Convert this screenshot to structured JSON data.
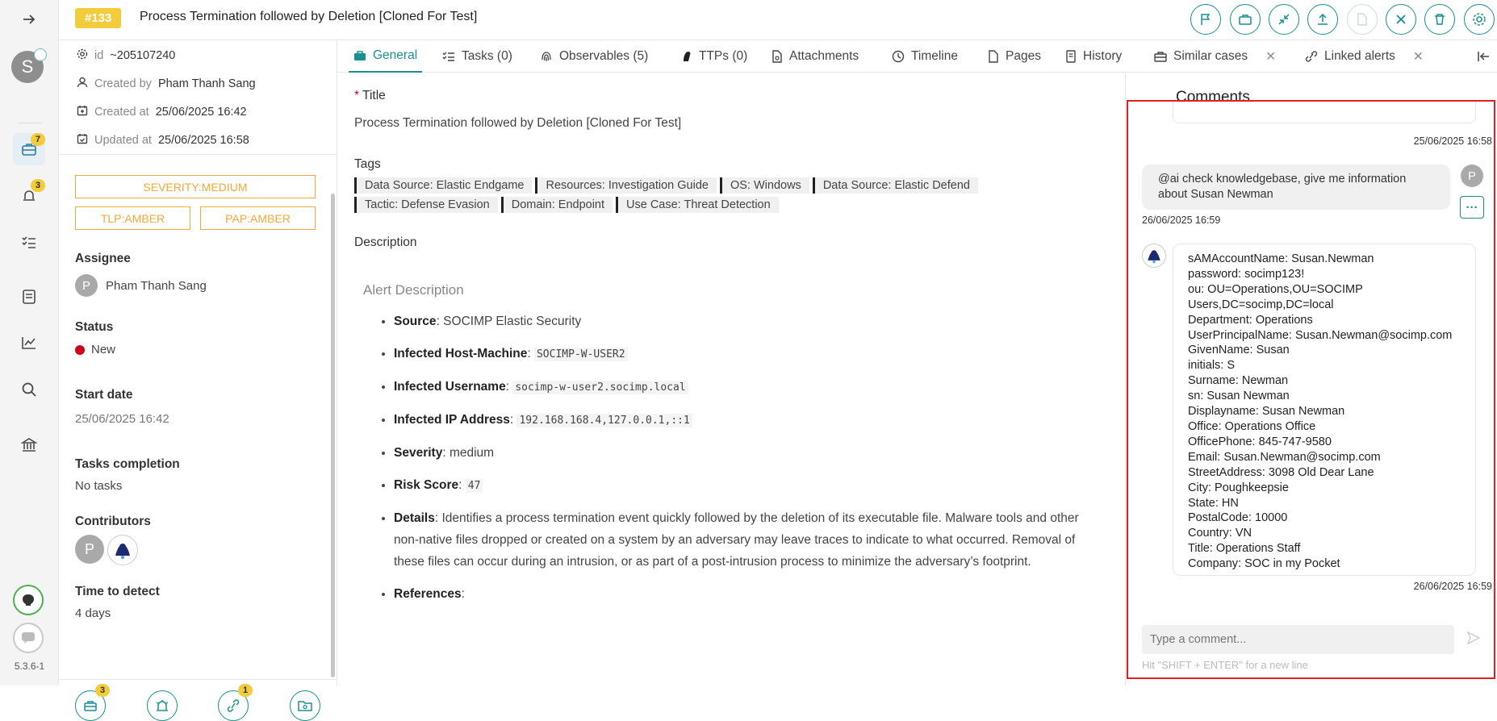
{
  "nav": {
    "avatar_letter": "S",
    "cases_badge": "7",
    "alerts_badge": "3",
    "version": "5.3.6-1"
  },
  "header": {
    "case_number": "#133",
    "title": "Process Termination followed by Deletion [Cloned For Test]"
  },
  "details": {
    "id_label": "id",
    "id_value": "~205107240",
    "created_by_label": "Created by",
    "created_by": "Pham Thanh Sang",
    "created_at_label": "Created at",
    "created_at": "25/06/2025 16:42",
    "updated_at_label": "Updated at",
    "updated_at": "25/06/2025 16:58",
    "severity": "SEVERITY:MEDIUM",
    "tlp": "TLP:AMBER",
    "pap": "PAP:AMBER",
    "assignee_label": "Assignee",
    "assignee_initial": "P",
    "assignee": "Pham Thanh Sang",
    "status_label": "Status",
    "status": "New",
    "status_color": "#d0021b",
    "start_date_label": "Start date",
    "start_date": "25/06/2025 16:42",
    "tasks_label": "Tasks completion",
    "tasks_value": "No tasks",
    "contributors_label": "Contributors",
    "contributor_initial": "P",
    "ttd_label": "Time to detect",
    "ttd_value": "4 days"
  },
  "bottom_badges": {
    "cases": "3",
    "observables": "1"
  },
  "tabs": [
    {
      "label": "General"
    },
    {
      "label": "Tasks (0)"
    },
    {
      "label": "Observables (5)"
    },
    {
      "label": "TTPs (0)"
    },
    {
      "label": "Attachments"
    },
    {
      "label": "Timeline"
    },
    {
      "label": "Pages"
    },
    {
      "label": "History"
    },
    {
      "label": "Similar cases"
    },
    {
      "label": "Linked alerts"
    }
  ],
  "general": {
    "title_label": "Title",
    "required_mark": "*",
    "title_value": "Process Termination followed by Deletion [Cloned For Test]",
    "tags_label": "Tags",
    "tags": [
      "Data Source: Elastic Endgame",
      "Resources: Investigation Guide",
      "OS: Windows",
      "Data Source: Elastic Defend",
      "Tactic: Defense Evasion",
      "Domain: Endpoint",
      "Use Case: Threat Detection"
    ],
    "description_label": "Description",
    "alert_heading": "Alert Description",
    "items": [
      {
        "k": "Source",
        "v": ": SOCIMP Elastic Security"
      },
      {
        "k": "Infected Host-Machine",
        "v": ": ",
        "code": "SOCIMP-W-USER2"
      },
      {
        "k": "Infected Username",
        "v": ": ",
        "code": "socimp-w-user2.socimp.local"
      },
      {
        "k": "Infected IP Address",
        "v": ": ",
        "code": "192.168.168.4,127.0.0.1,::1"
      },
      {
        "k": "Severity",
        "v": ": medium"
      },
      {
        "k": "Risk Score",
        "v": ": ",
        "code": "47"
      },
      {
        "k": "Details",
        "v": ": Identifies a process termination event quickly followed by the deletion of its executable file. Malware tools and other non-native files dropped or created on a system by an adversary may leave traces to indicate to what occurred. Removal of these files can occur during an intrusion, or as part of a post-intrusion process to minimize the adversary’s footprint."
      },
      {
        "k": "References",
        "v": ":"
      }
    ]
  },
  "comments": {
    "heading": "Comments",
    "ts1": "25/06/2025 16:58",
    "user_msg": "@ai check knowledgebase, give me information about Susan Newman",
    "user_initial": "P",
    "ts2": "26/06/2025 16:59",
    "ai_lines": [
      "sAMAccountName: Susan.Newman",
      "password: socimp123!",
      "ou: OU=Operations,OU=SOCIMP",
      "Users,DC=socimp,DC=local",
      "Department: Operations",
      "UserPrincipalName: Susan.Newman@socimp.com",
      "GivenName: Susan",
      "initials: S",
      "Surname: Newman",
      "sn: Susan Newman",
      "Displayname: Susan Newman",
      "Office: Operations Office",
      "OfficePhone: 845-747-9580",
      "Email: Susan.Newman@socimp.com",
      "StreetAddress: 3098 Old Dear Lane",
      "City: Poughkeepsie",
      "State: HN",
      "PostalCode: 10000",
      "Country: VN",
      "Title: Operations Staff",
      "Company: SOC in my Pocket"
    ],
    "ts3": "26/06/2025 16:59",
    "placeholder": "Type a comment...",
    "hint": "Hit \"SHIFT + ENTER\" for a new line"
  },
  "colors": {
    "accent": "#1a8f8f",
    "highlight": "#e02020",
    "badge": "#f2cc3a",
    "amber": "#f2a83a"
  }
}
